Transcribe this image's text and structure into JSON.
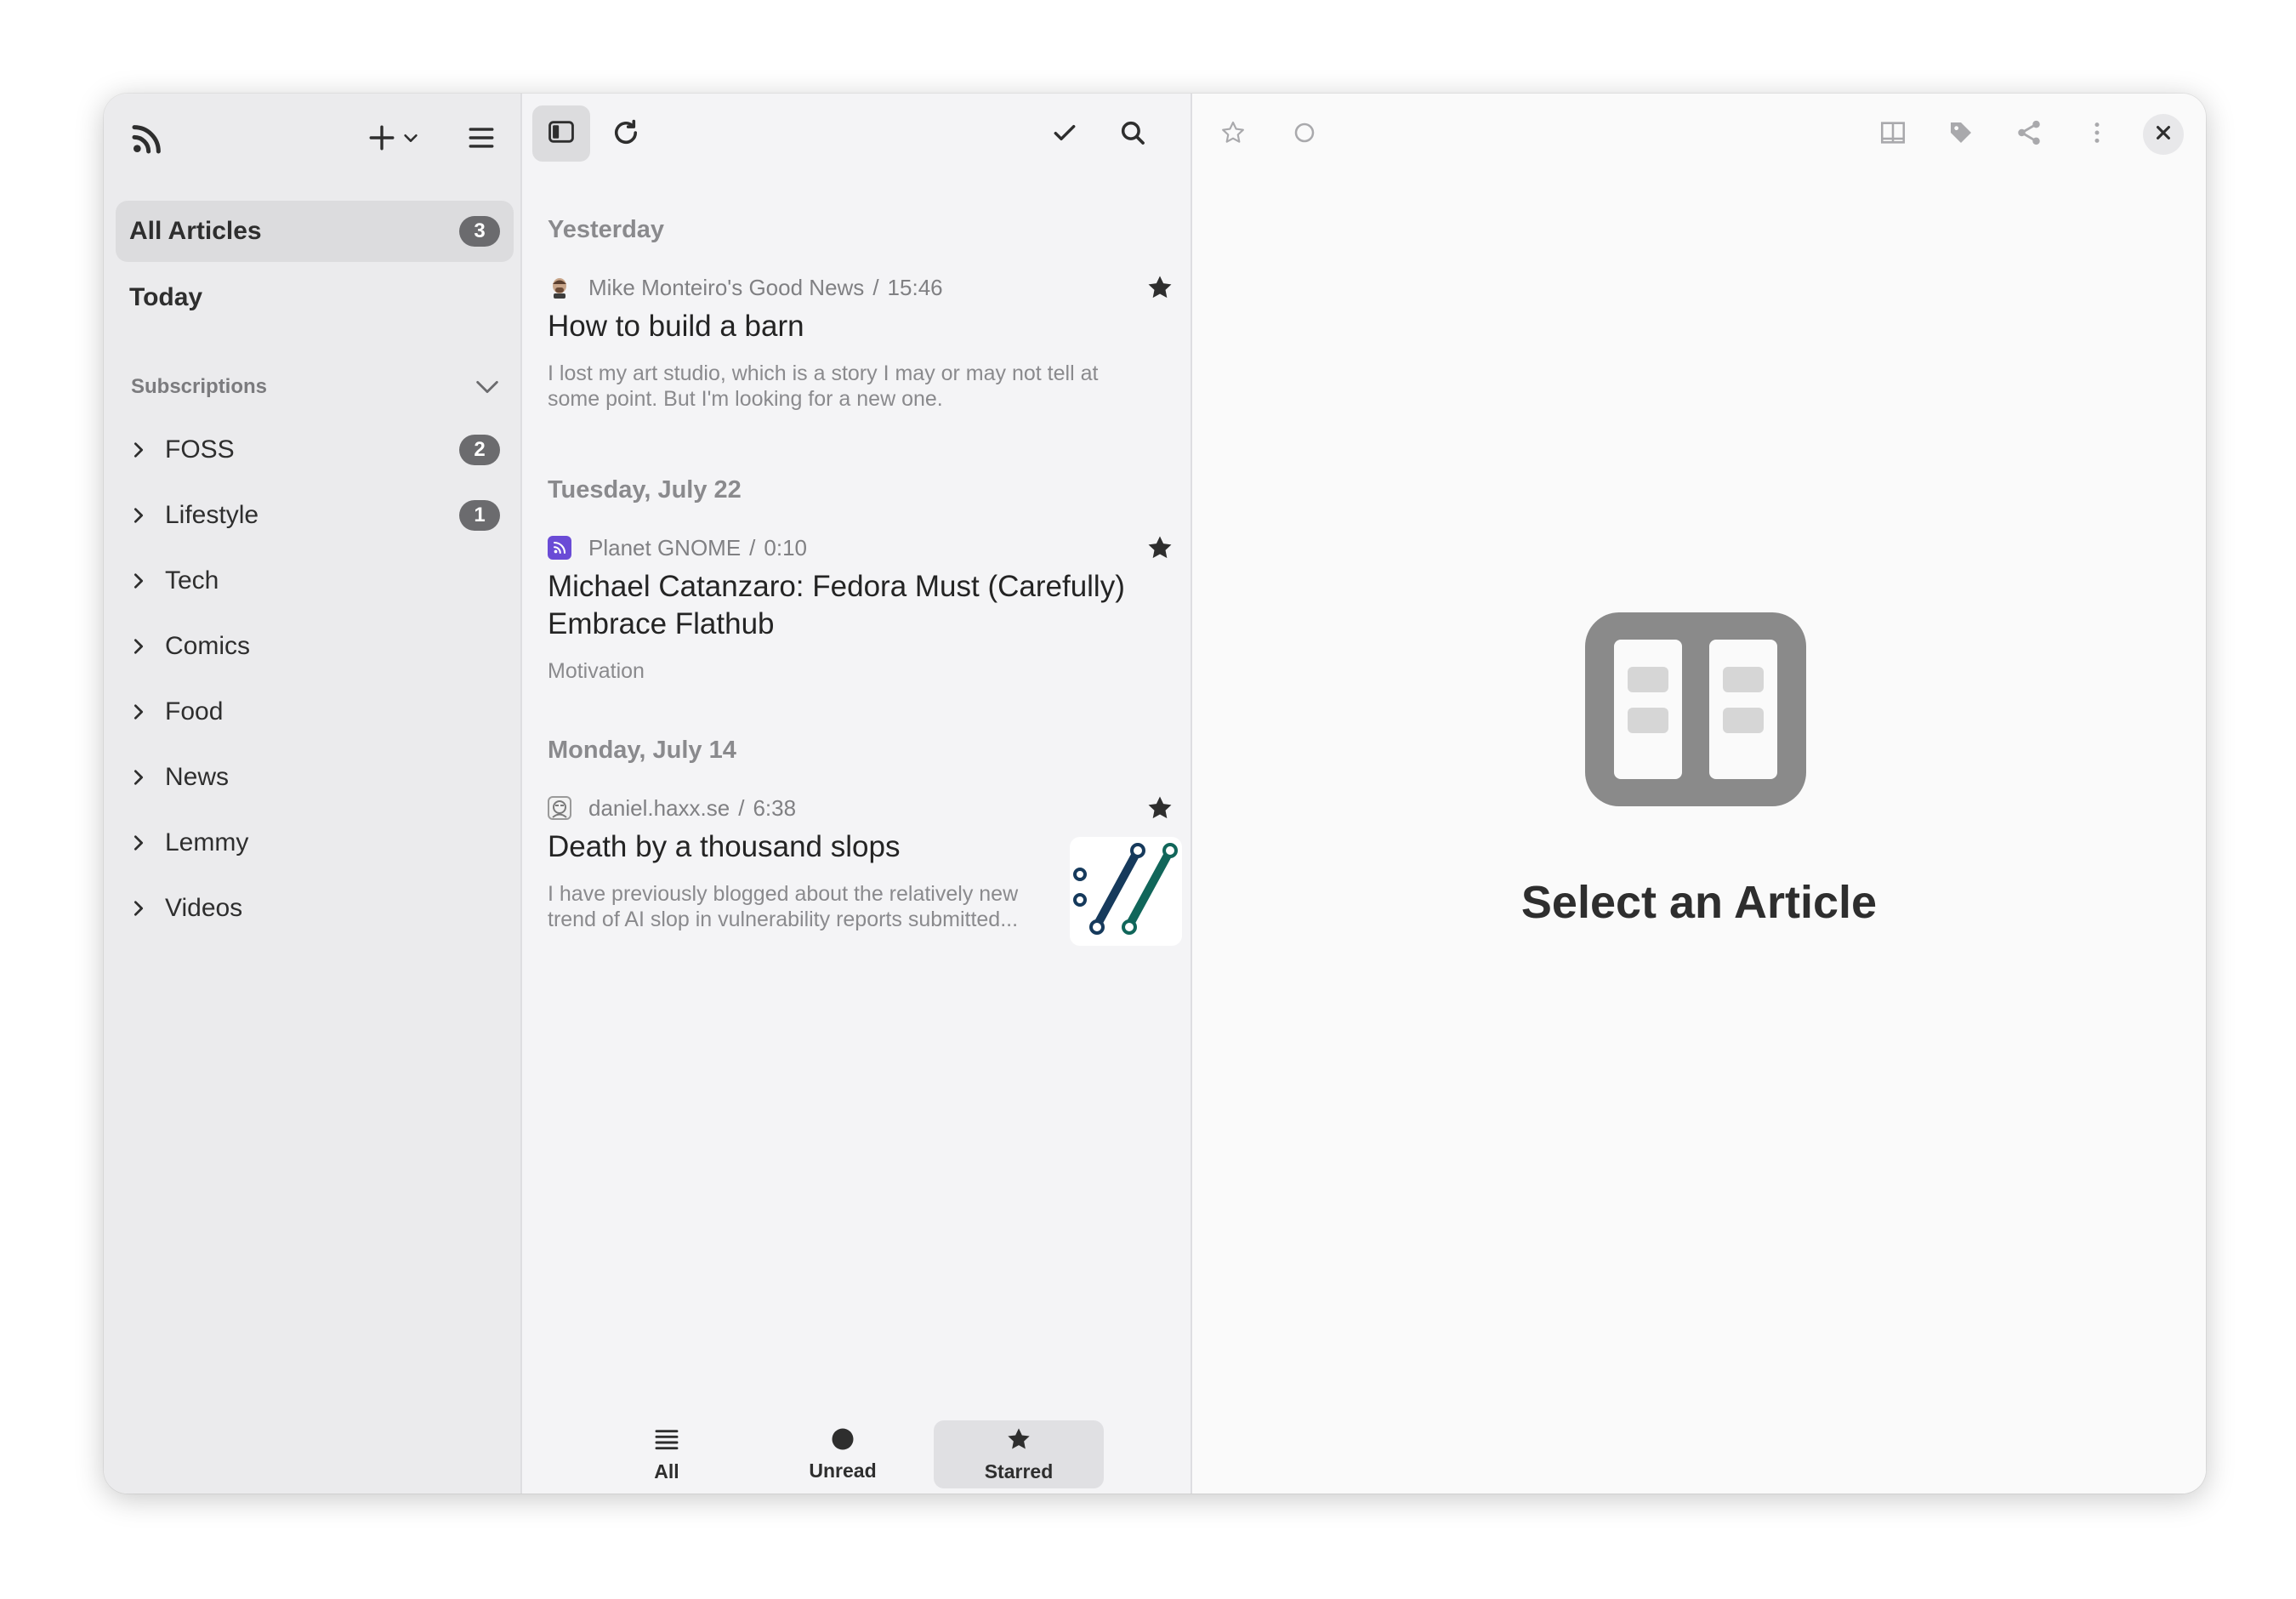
{
  "sidebar": {
    "all_articles": {
      "label": "All Articles",
      "count": "3"
    },
    "today": {
      "label": "Today"
    },
    "subscriptions_label": "Subscriptions",
    "categories": [
      {
        "label": "FOSS",
        "count": "2"
      },
      {
        "label": "Lifestyle",
        "count": "1"
      },
      {
        "label": "Tech"
      },
      {
        "label": "Comics"
      },
      {
        "label": "Food"
      },
      {
        "label": "News"
      },
      {
        "label": "Lemmy"
      },
      {
        "label": "Videos"
      }
    ]
  },
  "list": {
    "groups": [
      {
        "day": "Yesterday",
        "article": {
          "feed": "Mike Monteiro's Good News",
          "sep": "/",
          "time": "15:46",
          "title": "How to build a barn",
          "summary_line1": "I lost my art studio, which is a story I may or may not tell at",
          "summary_line2": "some point. But I'm looking for a new one."
        }
      },
      {
        "day": "Tuesday, July 22",
        "article": {
          "feed": "Planet GNOME",
          "sep": "/",
          "time": "0:10",
          "title_line1": "Michael Catanzaro: Fedora Must (Carefully)",
          "title_line2": "Embrace Flathub",
          "summary": "Motivation"
        }
      },
      {
        "day": "Monday, July 14",
        "article": {
          "feed": "daniel.haxx.se",
          "sep": "/",
          "time": "6:38",
          "title": "Death by a thousand slops",
          "summary_line1": "I have previously blogged about the relatively new",
          "summary_line2": "trend of AI slop in vulnerability reports submitted..."
        }
      }
    ],
    "views": [
      {
        "label": "All"
      },
      {
        "label": "Unread"
      },
      {
        "label": "Starred"
      }
    ]
  },
  "content": {
    "empty_title": "Select an Article"
  },
  "colors": {
    "sidebar_bg": "#ebebed",
    "list_bg": "#f4f4f6",
    "content_bg": "#fafafa",
    "badge": "#6b6b6e",
    "placeholder_icon": "#8a8a8a",
    "planet_gnome_icon": "#6a4bd6",
    "thumb_navy": "#163a5c",
    "thumb_teal": "#11665a"
  }
}
